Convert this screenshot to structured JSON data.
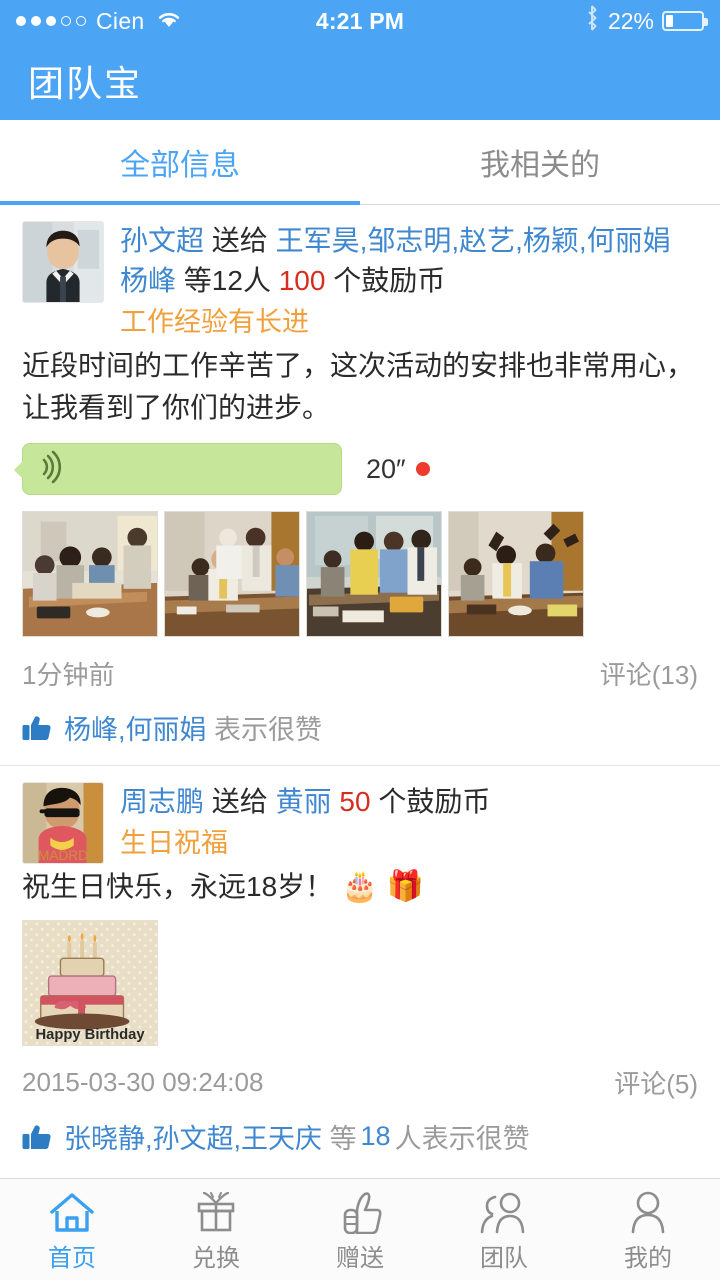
{
  "status_bar": {
    "signal_dots_filled": 3,
    "signal_dots_total": 5,
    "carrier": "Cien",
    "wifi_icon": "wifi-icon",
    "time": "4:21 PM",
    "bluetooth_icon": "bluetooth-icon",
    "battery_percent": "22%",
    "battery_level": 22
  },
  "nav": {
    "title": "团队宝"
  },
  "tabs": [
    {
      "label": "全部信息",
      "active": true
    },
    {
      "label": "我相关的",
      "active": false
    }
  ],
  "posts": [
    {
      "avatar_name": "avatar-sun-wenchao",
      "sender": "孙文超",
      "verb": "送给",
      "receivers": "王军昊,邹志明,赵艺,杨颖,何丽娟杨峰",
      "others": "等12人",
      "amount": "100",
      "unit": "个鼓励币",
      "tag": "工作经验有长进",
      "message": "近段时间的工作辛苦了，这次活动的安排也非常用心，让我看到了你们的进步。",
      "voice": {
        "duration": "20″",
        "unread": true
      },
      "photos": [
        "meeting-photo-1",
        "meeting-photo-2",
        "meeting-photo-3",
        "meeting-photo-4"
      ],
      "time": "1分钟前",
      "comments": "评论(13)",
      "like_icon": "thumbs-up-icon",
      "like_names": "杨峰,何丽娟",
      "like_suffix": "表示很赞"
    },
    {
      "avatar_name": "avatar-zhou-zhipeng",
      "sender": "周志鹏",
      "verb": "送给",
      "receivers": "黄丽",
      "others": "",
      "amount": "50",
      "unit": "个鼓励币",
      "tag": "生日祝福",
      "message": "祝生日快乐，永远18岁！",
      "emoji": "🎂 🎁",
      "image": "happy-birthday-cake-image",
      "image_caption": "Happy Birthday",
      "time": "2015-03-30 09:24:08",
      "comments": "评论(5)",
      "like_icon": "thumbs-up-icon",
      "like_names": "张晓静,孙文超,王天庆",
      "like_mid": "等",
      "like_count": "18",
      "like_suffix": "人表示很赞"
    }
  ],
  "tab_bar": [
    {
      "label": "首页",
      "icon": "home-icon",
      "active": true
    },
    {
      "label": "兑换",
      "icon": "gift-icon",
      "active": false
    },
    {
      "label": "赠送",
      "icon": "thumbs-up-icon",
      "active": false
    },
    {
      "label": "团队",
      "icon": "people-icon",
      "active": false
    },
    {
      "label": "我的",
      "icon": "person-icon",
      "active": false
    }
  ],
  "colors": {
    "brand_blue": "#4ca4f5",
    "link_blue": "#3f88d0",
    "amount_red": "#d62d20",
    "tag_orange": "#f0a03c",
    "voice_green": "#c6e79a",
    "unread_red": "#ee3b2f",
    "muted_gray": "#9b9b9b"
  }
}
